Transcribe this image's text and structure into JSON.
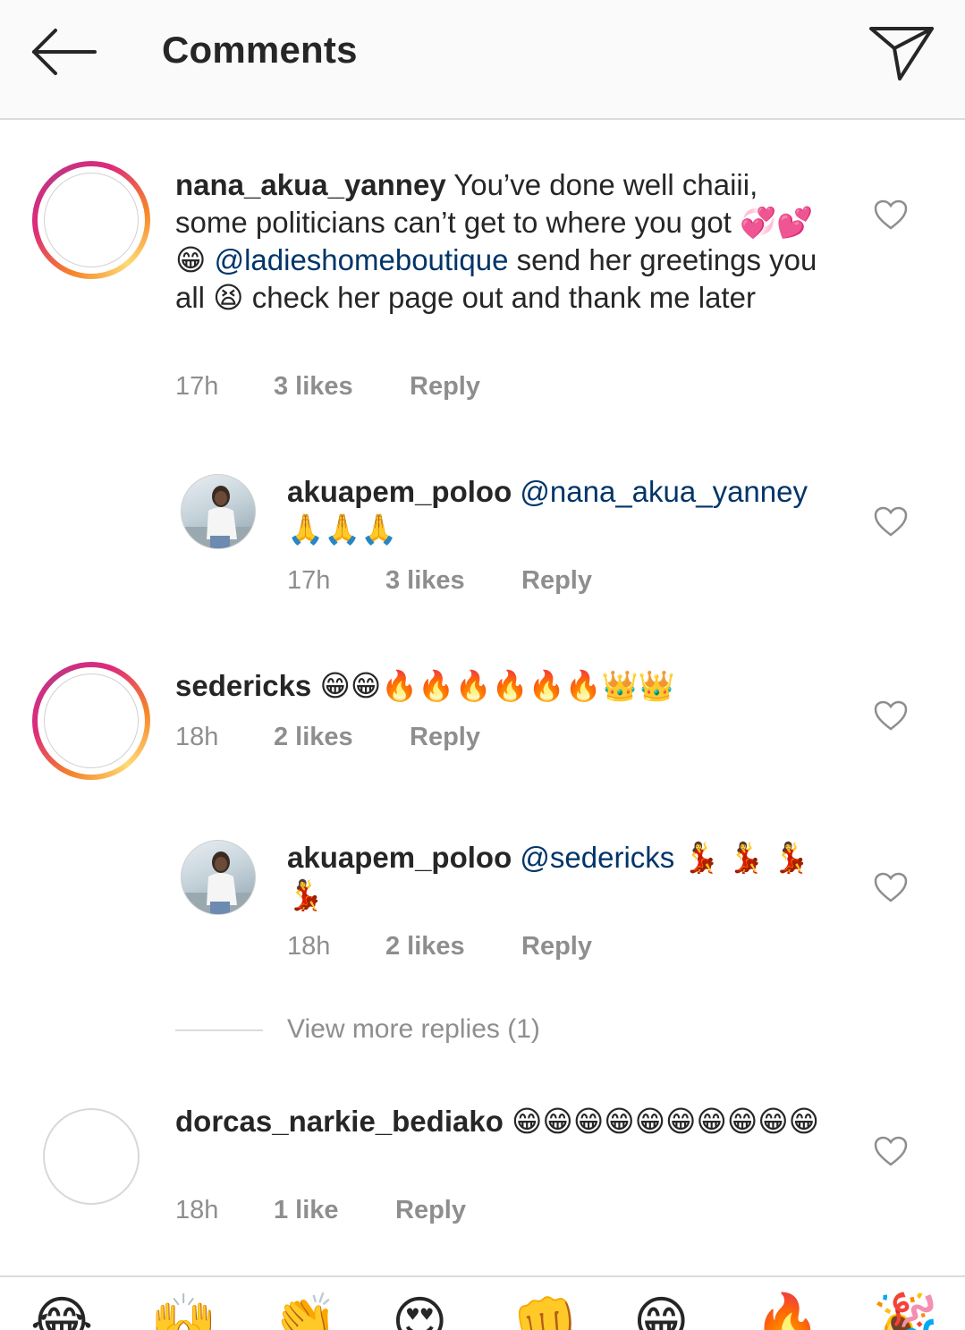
{
  "header": {
    "title": "Comments",
    "back_icon": "arrow-left-icon",
    "send_icon": "paper-plane-icon"
  },
  "comments": [
    {
      "username": "nana_akua_yanney",
      "text_before_mention": " You’ve done well chaiii, some politicians can’t get to where you got 💞💕😁 ",
      "mention": "@ladieshomeboutique",
      "text_after_mention": " send her greetings you all 😫 check her page out and thank me later",
      "time": "17h",
      "likes": "3 likes",
      "reply": "Reply"
    },
    {
      "username": "akuapem_poloo",
      "mention": "@nana_akua_yanney",
      "text_after_mention": " 🙏🙏🙏",
      "time": "17h",
      "likes": "3 likes",
      "reply": "Reply"
    },
    {
      "username": "sedericks",
      "text": " 😁😁🔥🔥🔥🔥🔥🔥👑👑",
      "time": "18h",
      "likes": "2 likes",
      "reply": "Reply"
    },
    {
      "username": "akuapem_poloo",
      "mention": "@sedericks",
      "text_after_mention": " 💃 💃 💃 💃",
      "time": "18h",
      "likes": "2 likes",
      "reply": "Reply"
    },
    {
      "username": "dorcas_narkie_bediako",
      "text": " 😁😁😁😁😁😁😁😁😁😁",
      "time": "18h",
      "likes": "1 like",
      "reply": "Reply"
    }
  ],
  "view_more_replies": "View more replies (1)",
  "quick_reactions": [
    "😂",
    "🙌",
    "👏",
    "😍",
    "👊",
    "😁",
    "🔥",
    "🎉"
  ],
  "colors": {
    "mention": "#003569",
    "meta": "#8e8e8e",
    "ring_start": "#f58529",
    "ring_end": "#dd2a7b"
  }
}
